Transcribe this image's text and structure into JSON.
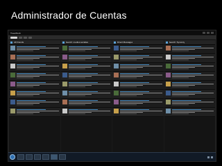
{
  "slide": {
    "title": "Administrador de Cuentas"
  },
  "app": {
    "window_title": "TweetDeck",
    "columns": [
      {
        "name": "All Friends",
        "icon": "people-icon",
        "count": "",
        "tweets": 8
      },
      {
        "name": "Search: medios sociales",
        "icon": "search-icon",
        "count": "",
        "tweets": 8
      },
      {
        "name": "Direct Messages",
        "icon": "mail-icon",
        "count": "",
        "tweets": 8
      },
      {
        "name": "Search: Symonty",
        "icon": "search-icon",
        "count": "",
        "tweets": 8
      }
    ]
  },
  "taskbar": {
    "apps": [
      "windows-explorer",
      "browser",
      "media-player",
      "folder",
      "tweetdeck",
      "app"
    ],
    "active_app": "tweetdeck"
  },
  "colors": {
    "background": "#000000",
    "title_text": "#ffffff",
    "column_bg": "#141414",
    "link": "#4d8fc4"
  }
}
